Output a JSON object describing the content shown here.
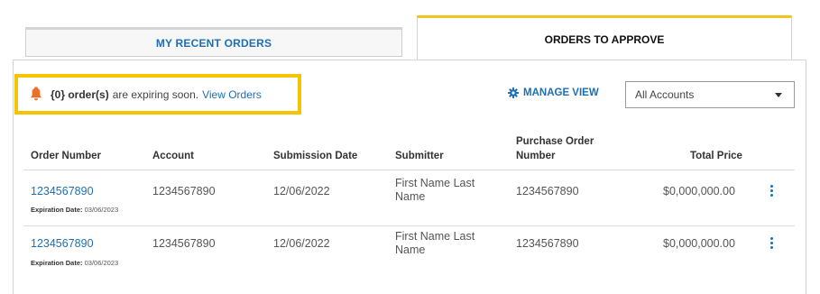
{
  "tabs": {
    "recent_orders": "MY RECENT ORDERS",
    "orders_to_approve": "ORDERS TO APPROVE"
  },
  "alert": {
    "count": "{0} order(s)",
    "text": "are expiring soon.",
    "link": "View Orders",
    "icon": "bell-icon",
    "icon_color": "#e8722b",
    "highlight_color": "#f5c400"
  },
  "toolbar": {
    "manage_view_label": "MANAGE VIEW",
    "account_select_value": "All Accounts"
  },
  "table": {
    "headers": {
      "order_number": "Order Number",
      "account": "Account",
      "submission_date": "Submission Date",
      "submitter": "Submitter",
      "purchase_order_line1": "Purchase Order",
      "purchase_order_line2": "Number",
      "total_price": "Total Price"
    },
    "rows": [
      {
        "order_number": "1234567890",
        "expiration_label": "Expiration Date:",
        "expiration_date": "03/06/2023",
        "account": "1234567890",
        "submission_date": "12/06/2022",
        "submitter_line1": "First Name Last",
        "submitter_line2": "Name",
        "purchase_order_number": "1234567890",
        "total_price": "$0,000,000.00"
      },
      {
        "order_number": "1234567890",
        "expiration_label": "Expiration Date:",
        "expiration_date": "03/06/2023",
        "account": "1234567890",
        "submission_date": "12/06/2022",
        "submitter_line1": "First Name Last",
        "submitter_line2": "Name",
        "purchase_order_number": "1234567890",
        "total_price": "$0,000,000.00"
      }
    ]
  },
  "colors": {
    "accent_blue": "#1c6fb5",
    "active_tab_border": "#f2c31c"
  }
}
